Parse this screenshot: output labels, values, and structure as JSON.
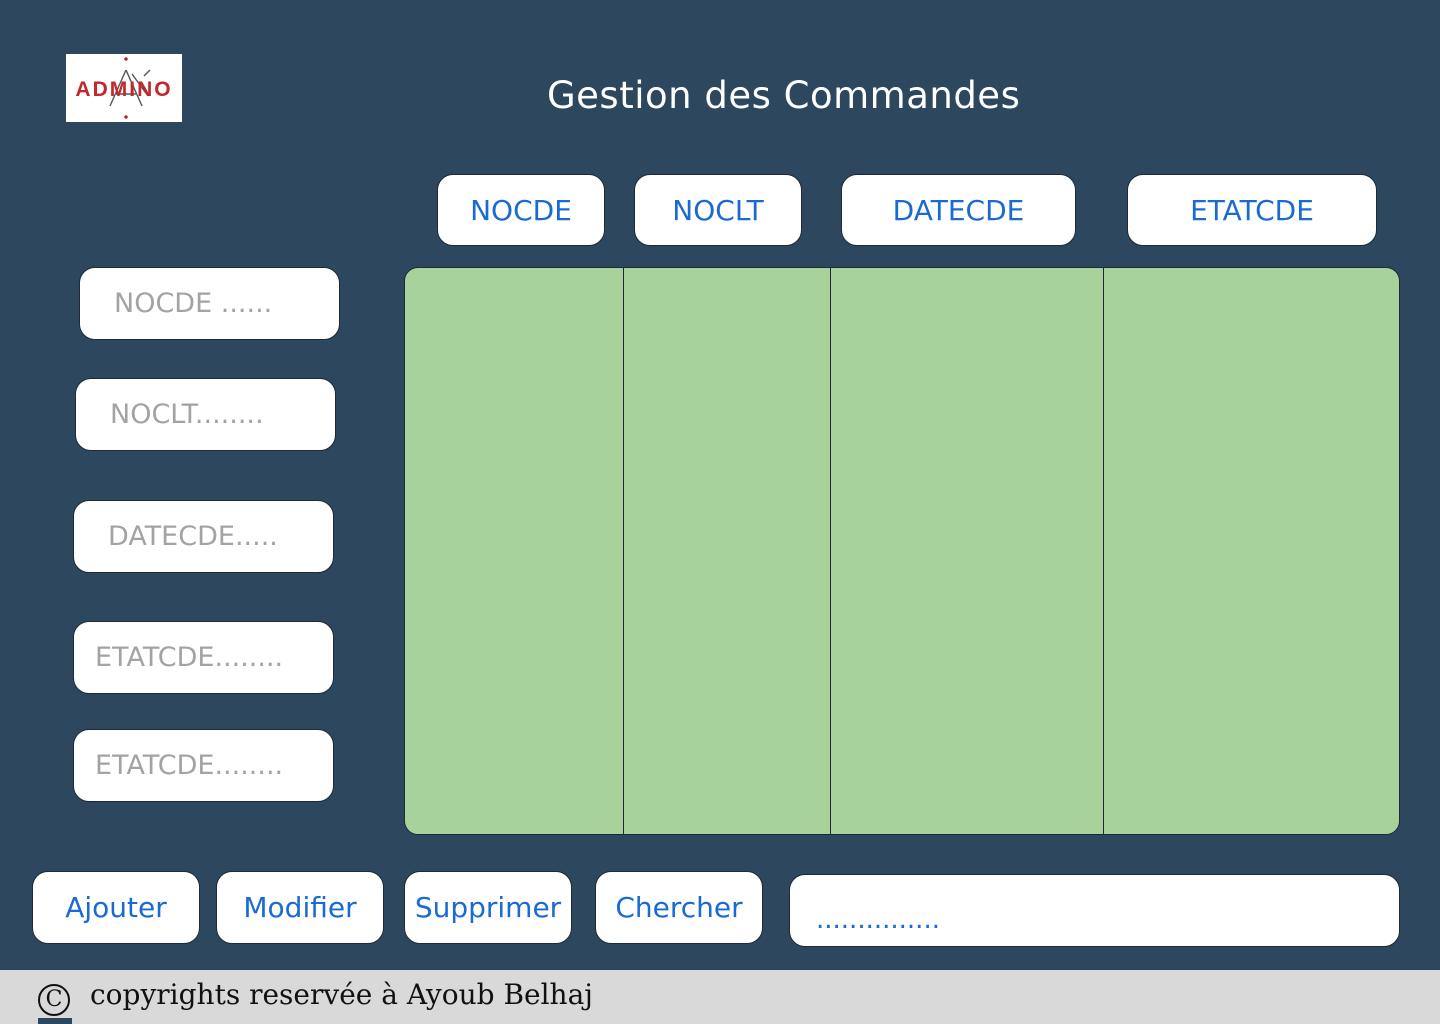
{
  "header": {
    "logo_text": "ADMINO",
    "title": "Gestion des Commandes"
  },
  "table": {
    "columns": [
      {
        "label": "NOCDE"
      },
      {
        "label": "NOCLT"
      },
      {
        "label": "DATECDE"
      },
      {
        "label": "ETATCDE"
      }
    ],
    "rows": []
  },
  "form": {
    "fields": [
      {
        "placeholder": "NOCDE ......"
      },
      {
        "placeholder": "NOCLT........"
      },
      {
        "placeholder": "DATECDE....."
      },
      {
        "placeholder": "ETATCDE........"
      },
      {
        "placeholder": "ETATCDE........"
      }
    ]
  },
  "actions": {
    "add": "Ajouter",
    "edit": "Modifier",
    "delete": "Supprimer",
    "search": "Chercher"
  },
  "search": {
    "placeholder": "..............."
  },
  "footer": {
    "copyright_symbol": "C",
    "text": "copyrights reservée à Ayoub Belhaj"
  },
  "colors": {
    "background": "#2c475e",
    "grid": "#a8d29c",
    "accent": "#1a6ad4",
    "logo_red": "#c0282d"
  }
}
